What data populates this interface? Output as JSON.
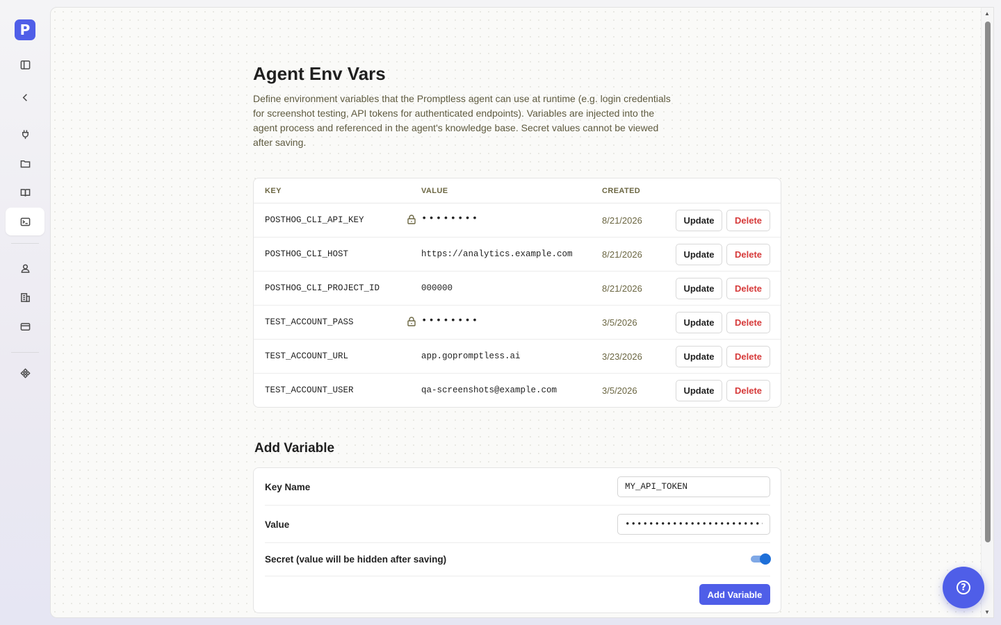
{
  "app": {
    "logo_letter": "P"
  },
  "sidebar": {
    "items": [
      {
        "name": "sidebar-toggle-icon"
      },
      {
        "name": "back-icon"
      },
      {
        "name": "plug-icon"
      },
      {
        "name": "folder-icon"
      },
      {
        "name": "book-icon"
      },
      {
        "name": "terminal-icon",
        "active": true
      },
      {
        "name": "user-icon"
      },
      {
        "name": "building-icon"
      },
      {
        "name": "credit-card-icon"
      },
      {
        "name": "integrations-icon"
      }
    ]
  },
  "page": {
    "title": "Agent Env Vars",
    "description": "Define environment variables that the Promptless agent can use at runtime (e.g. login credentials for screenshot testing, API tokens for authenticated endpoints). Variables are injected into the agent process and referenced in the agent's knowledge base. Secret values cannot be viewed after saving."
  },
  "table": {
    "headers": {
      "key": "KEY",
      "value": "VALUE",
      "created": "CREATED"
    },
    "update_label": "Update",
    "delete_label": "Delete",
    "rows": [
      {
        "key": "POSTHOG_CLI_API_KEY",
        "secret": true,
        "value": "••••••••",
        "created": "8/21/2026"
      },
      {
        "key": "POSTHOG_CLI_HOST",
        "secret": false,
        "value": "https://analytics.example.com",
        "created": "8/21/2026"
      },
      {
        "key": "POSTHOG_CLI_PROJECT_ID",
        "secret": false,
        "value": "000000",
        "created": "8/21/2026"
      },
      {
        "key": "TEST_ACCOUNT_PASS",
        "secret": true,
        "value": "••••••••",
        "created": "3/5/2026"
      },
      {
        "key": "TEST_ACCOUNT_URL",
        "secret": false,
        "value": "app.gopromptless.ai",
        "created": "3/23/2026"
      },
      {
        "key": "TEST_ACCOUNT_USER",
        "secret": false,
        "value": "qa-screenshots@example.com",
        "created": "3/5/2026"
      }
    ]
  },
  "add_form": {
    "title": "Add Variable",
    "key_label": "Key Name",
    "key_value": "MY_API_TOKEN",
    "value_label": "Value",
    "value_value": "••••••••••••••••••••••••••••",
    "secret_label": "Secret (value will be hidden after saving)",
    "secret_on": true,
    "submit_label": "Add Variable"
  },
  "help": {
    "label": "?"
  },
  "colors": {
    "accent": "#4f5ee8",
    "danger": "#d63a3a",
    "toggle": "#1e6fd8"
  }
}
